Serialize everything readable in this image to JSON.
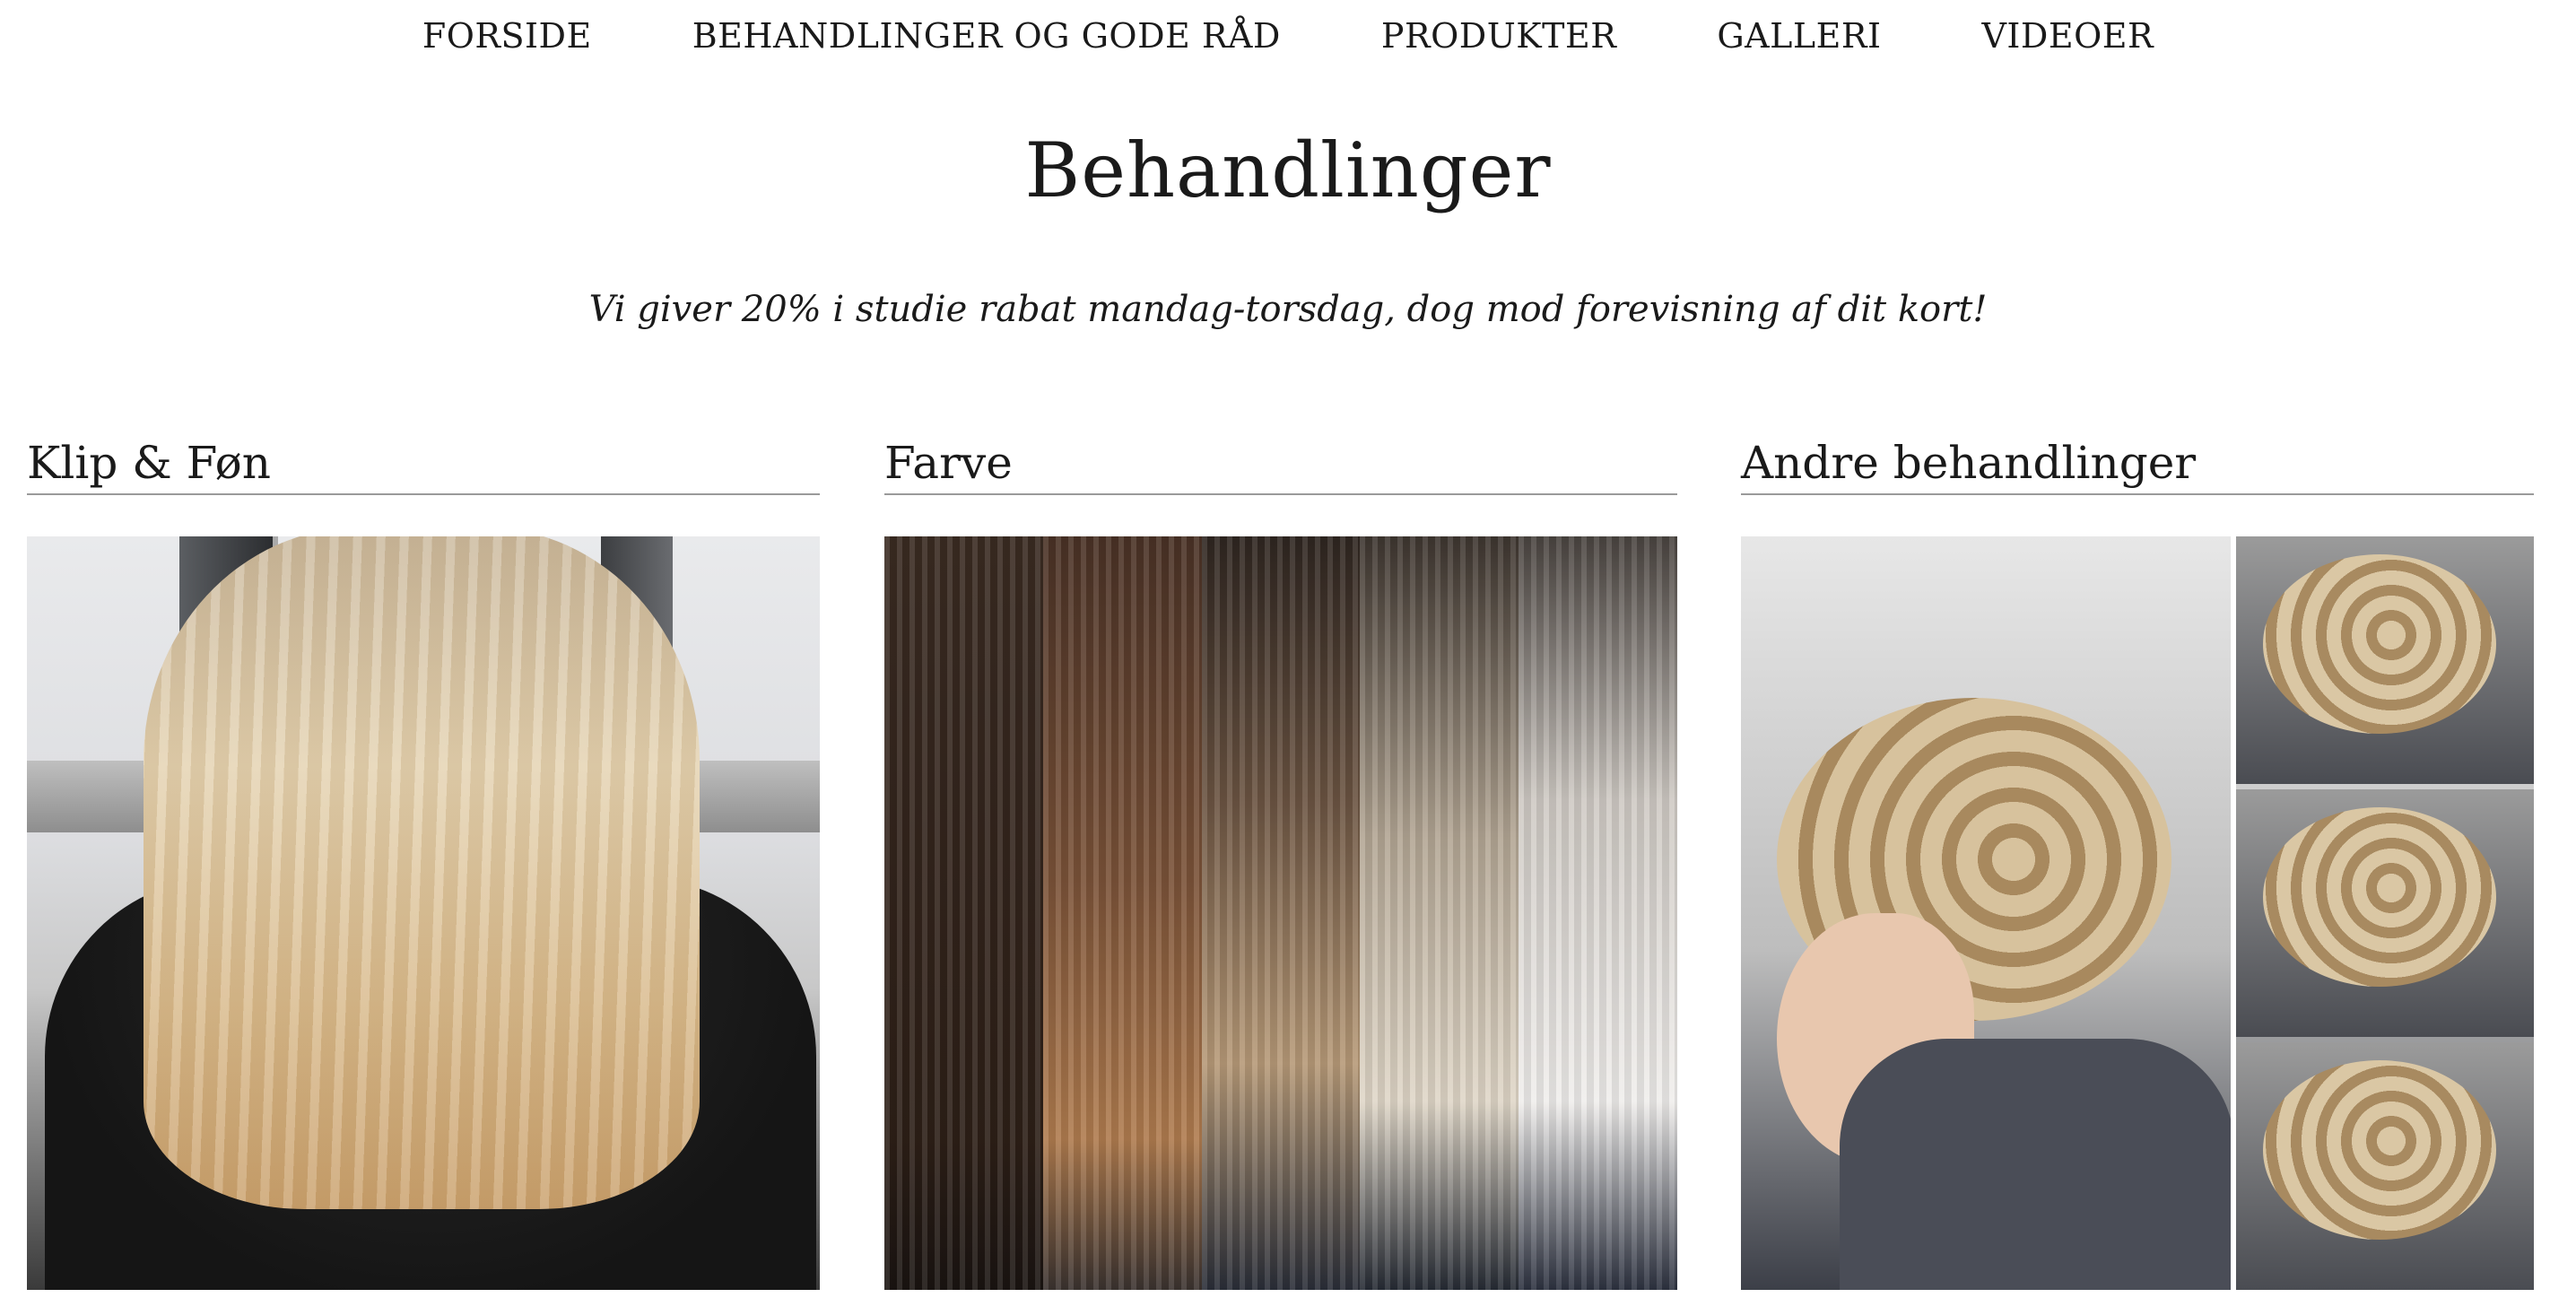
{
  "nav": {
    "items": [
      {
        "label": "FORSIDE"
      },
      {
        "label": "BEHANDLINGER OG GODE RÅD"
      },
      {
        "label": "PRODUKTER"
      },
      {
        "label": "GALLERI"
      },
      {
        "label": "VIDEOER"
      }
    ]
  },
  "page": {
    "title": "Behandlinger",
    "promo": "Vi giver 20% i studie rabat mandag-torsdag, dog mod forevisning af dit kort!"
  },
  "categories": [
    {
      "heading": "Klip & Føn"
    },
    {
      "heading": "Farve"
    },
    {
      "heading": "Andre behandlinger"
    }
  ]
}
